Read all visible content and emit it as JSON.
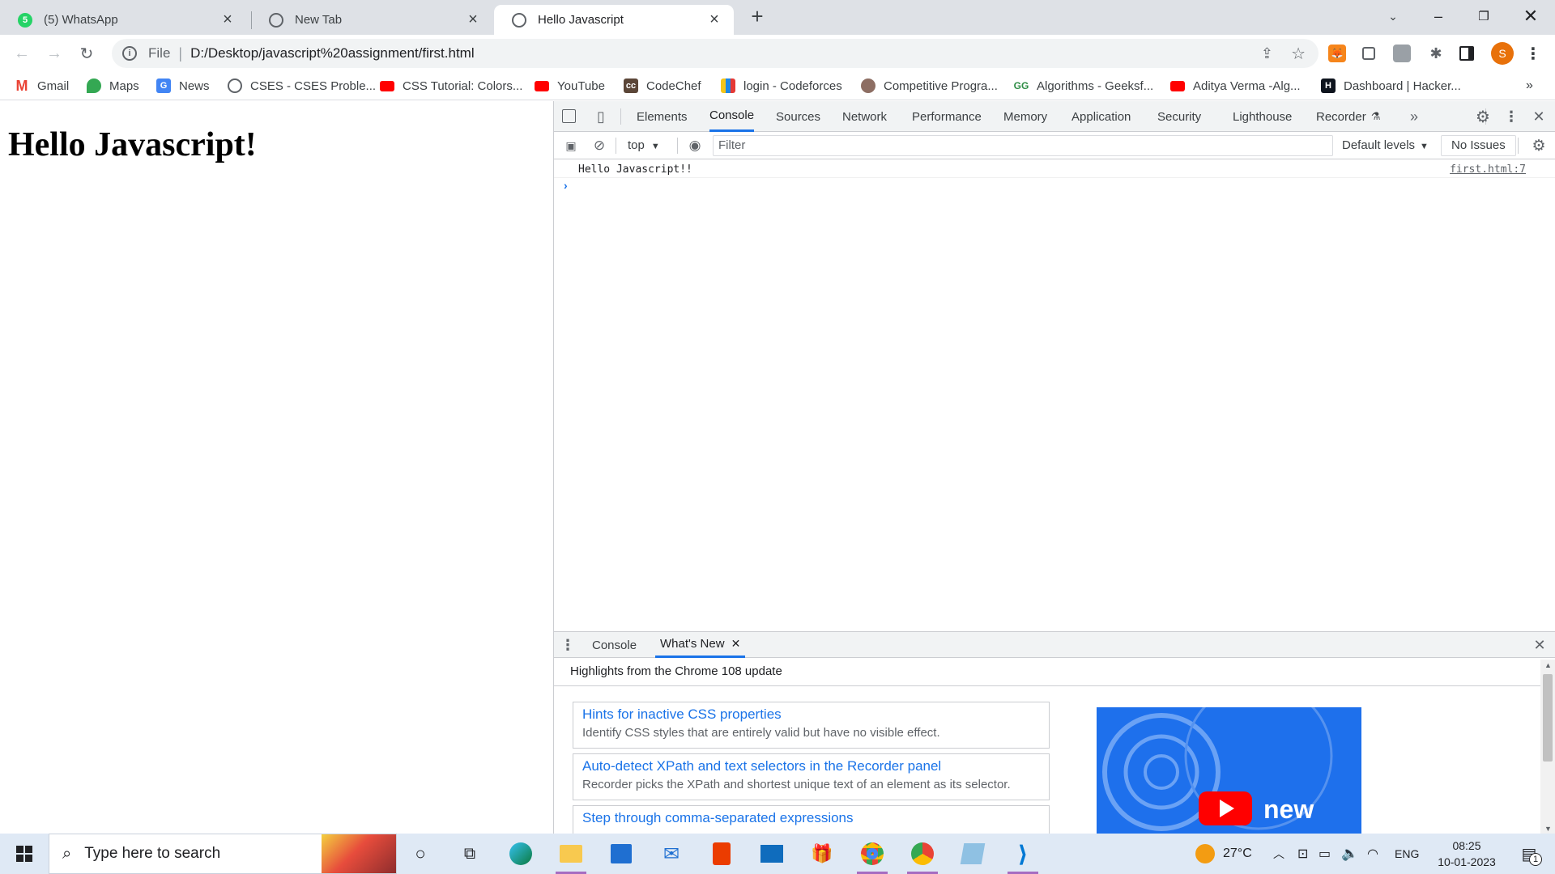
{
  "tabs": [
    {
      "title": "(5) WhatsApp",
      "icon": "whatsapp-icon"
    },
    {
      "title": "New Tab",
      "icon": "globe-icon"
    },
    {
      "title": "Hello Javascript",
      "icon": "globe-icon",
      "active": true
    }
  ],
  "address_bar": {
    "scheme": "File",
    "url": "D:/Desktop/javascript%20assignment/first.html"
  },
  "profile_initial": "S",
  "bookmarks": [
    "Gmail",
    "Maps",
    "News",
    "CSES - CSES Proble...",
    "CSS Tutorial: Colors...",
    "YouTube",
    "CodeChef",
    "login - Codeforces",
    "Competitive Progra...",
    "Algorithms - Geeksf...",
    "Aditya Verma -Alg...",
    "Dashboard | Hacker..."
  ],
  "page": {
    "heading": "Hello Javascript!"
  },
  "devtools": {
    "tabs": [
      "Elements",
      "Console",
      "Sources",
      "Network",
      "Performance",
      "Memory",
      "Application",
      "Security",
      "Lighthouse",
      "Recorder"
    ],
    "active_tab": "Console",
    "context": "top",
    "filter_placeholder": "Filter",
    "levels": "Default levels",
    "issues": "No Issues",
    "log": [
      {
        "message": "Hello Javascript!!",
        "source": "first.html:7"
      }
    ],
    "drawer": {
      "tabs": [
        "Console",
        "What's New"
      ],
      "active_tab": "What's New",
      "highlights": "Highlights from the Chrome 108 update",
      "cards": [
        {
          "title": "Hints for inactive CSS properties",
          "desc": "Identify CSS styles that are entirely valid but have no visible effect."
        },
        {
          "title": "Auto-detect XPath and text selectors in the Recorder panel",
          "desc": "Recorder picks the XPath and shortest unique text of an element as its selector."
        },
        {
          "title": "Step through comma-separated expressions",
          "desc": ""
        }
      ],
      "video_label": "new"
    }
  },
  "taskbar": {
    "search_placeholder": "Type here to search",
    "weather": "27°C",
    "language": "ENG",
    "time": "08:25",
    "date": "10-01-2023",
    "notifications": "1"
  }
}
